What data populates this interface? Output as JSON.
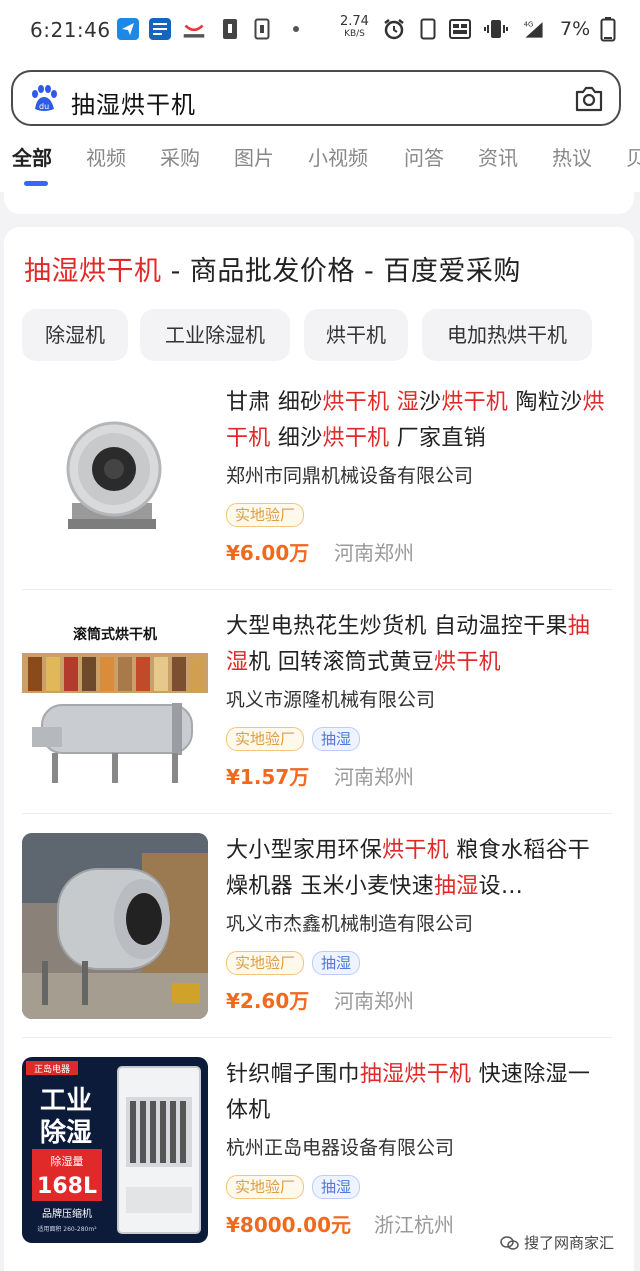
{
  "status_bar": {
    "time": "6:21:46",
    "net_speed_value": "2.74",
    "net_speed_unit": "KB/S",
    "network": "4G",
    "battery": "7%",
    "icons": [
      "send-icon",
      "news-icon",
      "shopping-icon",
      "sim-icon",
      "sim-icon",
      "dot-icon",
      "alarm-icon",
      "phone-icon",
      "volte-icon",
      "vibrate-icon",
      "signal-icon",
      "battery-icon"
    ]
  },
  "search": {
    "query": "抽湿烘干机",
    "logo_text": "du"
  },
  "tabs": [
    {
      "label": "全部",
      "active": true
    },
    {
      "label": "视频"
    },
    {
      "label": "采购"
    },
    {
      "label": "图片"
    },
    {
      "label": "小视频"
    },
    {
      "label": "问答"
    },
    {
      "label": "资讯"
    },
    {
      "label": "热议"
    },
    {
      "label": "贝"
    }
  ],
  "result": {
    "title_hl": "抽湿烘干机",
    "title_rest": " - 商品批发价格 - 百度爱采购",
    "chips": [
      "除湿机",
      "工业除湿机",
      "烘干机",
      "电加热烘干机"
    ],
    "products": [
      {
        "title_segments": [
          {
            "t": "甘肃 细砂"
          },
          {
            "t": "烘干机",
            "hl": true
          },
          {
            "t": " "
          },
          {
            "t": "湿",
            "hl": true
          },
          {
            "t": "沙"
          },
          {
            "t": "烘干机",
            "hl": true
          },
          {
            "t": " 陶粒沙"
          },
          {
            "t": "烘干机",
            "hl": true
          },
          {
            "t": " 细沙"
          },
          {
            "t": "烘干机",
            "hl": true
          },
          {
            "t": " 厂家直销"
          }
        ],
        "company": "郑州市同鼎机械设备有限公司",
        "tags": [
          {
            "text": "实地验厂",
            "kind": "factory"
          }
        ],
        "price": "¥6.00万",
        "location": "河南郑州",
        "image": "fan-dryer"
      },
      {
        "title_segments": [
          {
            "t": "大型电热花生炒货机 自动温控干果"
          },
          {
            "t": "抽湿",
            "hl": true
          },
          {
            "t": "机 回转滚筒式黄豆"
          },
          {
            "t": "烘干机",
            "hl": true
          }
        ],
        "company": "巩义市源隆机械有限公司",
        "tags": [
          {
            "text": "实地验厂",
            "kind": "factory"
          },
          {
            "text": "抽湿",
            "kind": "kw"
          }
        ],
        "price": "¥1.57万",
        "location": "河南郑州",
        "image": "drum-dryer",
        "image_caption": "滚筒式烘干机"
      },
      {
        "title_segments": [
          {
            "t": "大小型家用环保"
          },
          {
            "t": "烘干机",
            "hl": true
          },
          {
            "t": " 粮食水稻谷干燥机器 玉米小麦快速"
          },
          {
            "t": "抽湿",
            "hl": true
          },
          {
            "t": "设…"
          }
        ],
        "company": "巩义市杰鑫机械制造有限公司",
        "tags": [
          {
            "text": "实地验厂",
            "kind": "factory"
          },
          {
            "text": "抽湿",
            "kind": "kw"
          }
        ],
        "price": "¥2.60万",
        "location": "河南郑州",
        "image": "drum-workshop"
      },
      {
        "title_segments": [
          {
            "t": "针织帽子围巾"
          },
          {
            "t": "抽湿烘干机",
            "hl": true
          },
          {
            "t": " 快速除湿一体机"
          }
        ],
        "company": "杭州正岛电器设备有限公司",
        "tags": [
          {
            "text": "实地验厂",
            "kind": "factory"
          },
          {
            "text": "抽湿",
            "kind": "kw"
          }
        ],
        "price": "¥8000.00元",
        "location": "浙江杭州",
        "image": "dehumidifier",
        "image_lines": [
          "正岛电器",
          "工业",
          "除湿",
          "除湿量",
          "168L",
          "品牌压缩机",
          "适用面积 260-280m²"
        ]
      }
    ]
  },
  "watermark": "搜了网商家汇"
}
